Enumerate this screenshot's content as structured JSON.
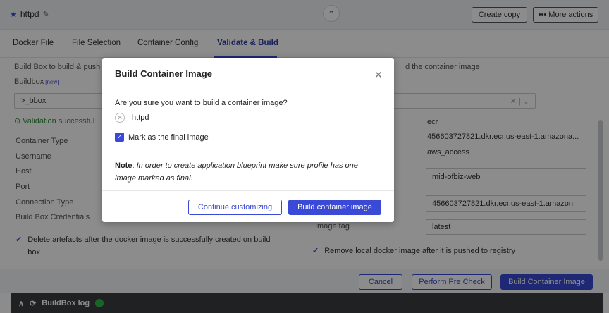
{
  "header": {
    "title": "httpd",
    "create_copy": "Create copy",
    "more_actions": "More actions"
  },
  "tabs": [
    {
      "label": "Docker File"
    },
    {
      "label": "File Selection"
    },
    {
      "label": "Container Config"
    },
    {
      "label": "Validate & Build"
    }
  ],
  "form": {
    "intro_left": "Build Box to build & push",
    "intro_right": "d the container image",
    "buildbox_label": "Buildbox",
    "buildbox_new": "[new]",
    "buildbox_value": ">_bbox",
    "validation": "Validation successful",
    "container_type_label": "Container Type",
    "container_type_value": "ecr",
    "username_label": "Username",
    "username_value": "456603727821.dkr.ecr.us-east-1.amazona...",
    "host_label": "Host",
    "host_value": "aws_access",
    "port_label": "Port",
    "repo_value": "mid-ofbiz-web",
    "connection_type_label": "Connection Type",
    "credentials_label": "Build Box Credentials",
    "registry_value": "456603727821.dkr.ecr.us-east-1.amazon",
    "image_tag_label": "Image tag",
    "image_tag_value": "latest",
    "delete_artefacts_line1": "Delete artefacts after the docker image is successfully created on build",
    "delete_artefacts_line2": "box",
    "remove_local": "Remove local docker image after it is pushed to registry"
  },
  "footer": {
    "cancel": "Cancel",
    "precheck": "Perform Pre Check",
    "build": "Build Container Image"
  },
  "log": {
    "label": "BuildBox log"
  },
  "modal": {
    "title": "Build Container Image",
    "question": "Are you sure you want to build a container image?",
    "image_name": "httpd",
    "final_label": "Mark as the final image",
    "note_label": "Note",
    "note_line1": "In order to create application blueprint make sure profile has one",
    "note_line2": "image marked as final.",
    "continue": "Continue customizing",
    "build": "Build container image"
  },
  "colors": {
    "accent": "#3a49d6",
    "success": "#2e8b3a",
    "logbar": "#3b3d40"
  }
}
